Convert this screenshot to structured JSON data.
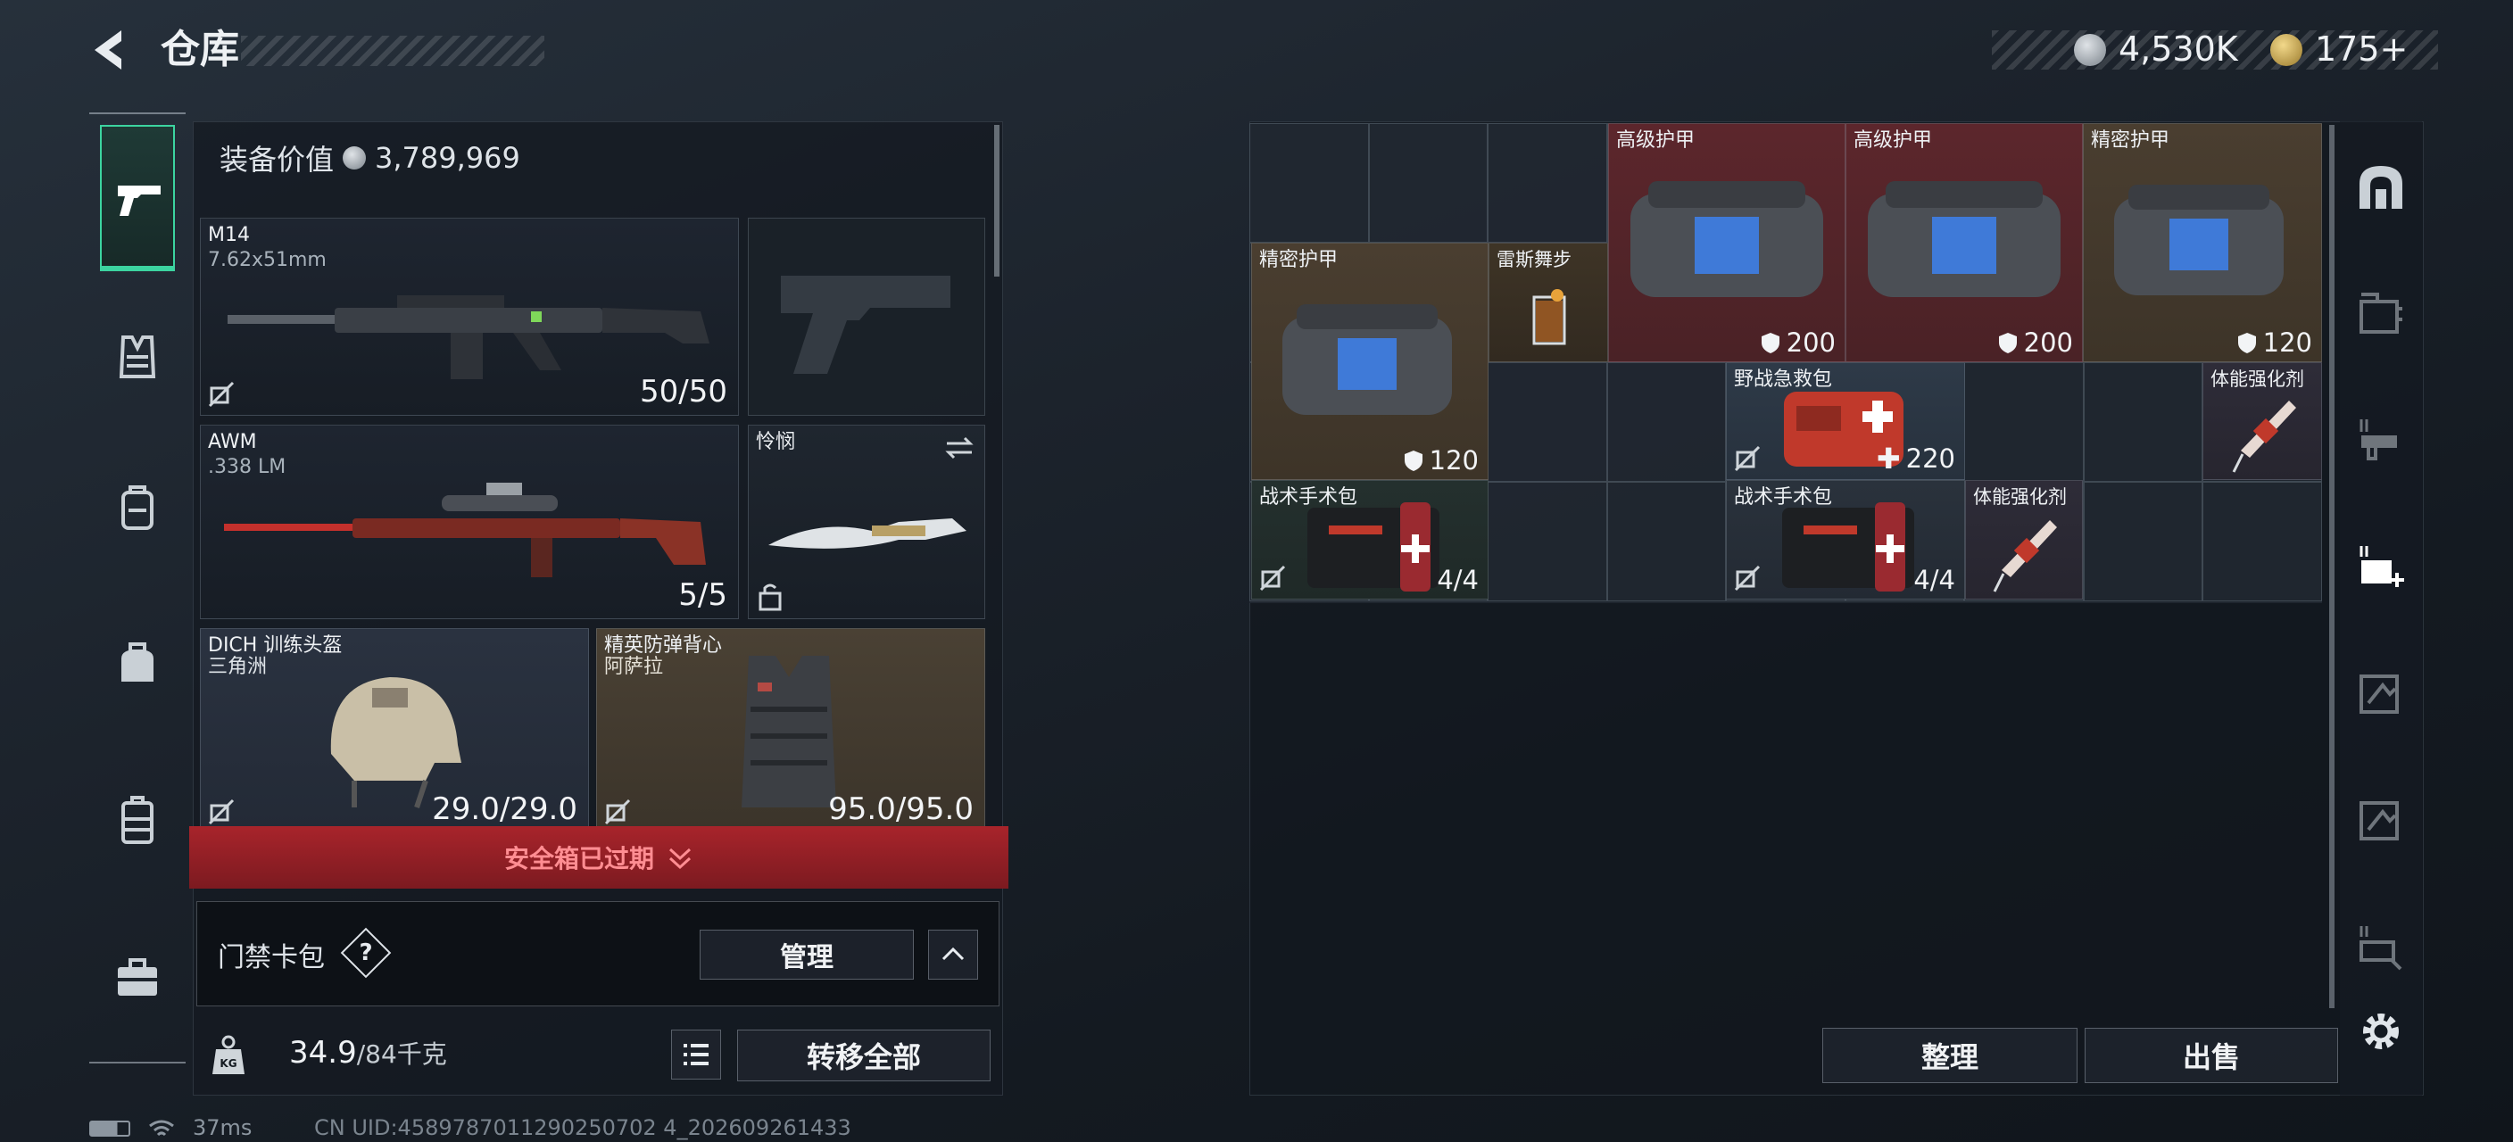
{
  "header": {
    "title": "仓库",
    "currency_primary": "4,530K",
    "currency_secondary": "175+"
  },
  "loadout": {
    "value_label": "装备价值",
    "value_amount": "3,789,969",
    "primary_weapon": {
      "name": "M14",
      "ammo_type": "7.62x51mm",
      "ammo": "50/50"
    },
    "secondary_weapon": {
      "name": "AWM",
      "ammo_type": ".338 LM",
      "ammo": "5/5"
    },
    "melee": {
      "name": "怜悯"
    },
    "helmet": {
      "name": "DICH 训练头盔",
      "faction": "三角洲",
      "durability": "29.0/29.0"
    },
    "armor": {
      "name": "精英防弹背心",
      "faction": "阿萨拉",
      "durability": "95.0/95.0"
    },
    "safebox_banner": "安全箱已过期",
    "keycard": {
      "label": "门禁卡包",
      "help": "?",
      "manage_button": "管理"
    },
    "weight": {
      "current": "34.9",
      "max": "/84千克"
    },
    "transfer_all_button": "转移全部"
  },
  "stash": {
    "items": [
      {
        "name": "高级护甲",
        "value": "200"
      },
      {
        "name": "高级护甲",
        "value": "200"
      },
      {
        "name": "精密护甲",
        "value": "120"
      },
      {
        "name": "精密护甲",
        "value": "120"
      },
      {
        "name": "雷斯舞步",
        "value": ""
      },
      {
        "name": "野战急救包",
        "value": "220"
      },
      {
        "name": "体能强化剂",
        "value": ""
      },
      {
        "name": "战术手术包",
        "value": "4/4"
      },
      {
        "name": "战术手术包",
        "value": "4/4"
      },
      {
        "name": "体能强化剂",
        "value": ""
      }
    ],
    "sort_button": "整理",
    "sell_button": "出售"
  },
  "status": {
    "ping": "37ms",
    "uid": "CN UID:4589787011290250702 4_202609261433"
  },
  "colors": {
    "banner_red": "#a8242b",
    "panel": "#1b222b",
    "accent_green": "#3cd4a0"
  }
}
